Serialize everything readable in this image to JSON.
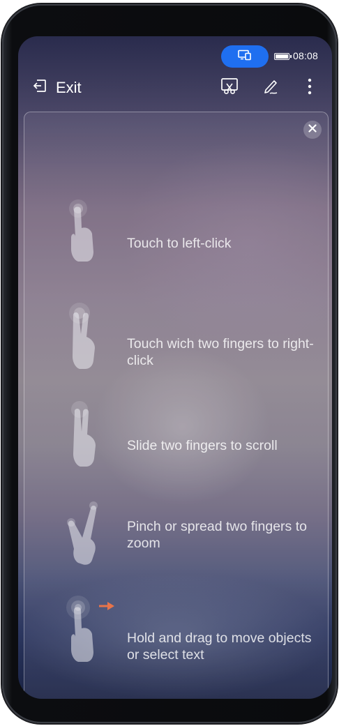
{
  "status_bar": {
    "time": "08:08",
    "cast_indicator_icon": "screen-mirroring-icon",
    "battery_icon": "battery-full-icon",
    "accent_color": "#1f6ff0"
  },
  "toolbar": {
    "exit_label": "Exit",
    "exit_icon": "exit-icon",
    "screenshot_icon": "screen-capture-icon",
    "annotate_icon": "pen-icon",
    "more_icon": "more-vertical-icon"
  },
  "tutorial": {
    "close_icon": "close-icon",
    "tips": [
      {
        "text": "Touch to left-click",
        "icon": "one-finger-tap-icon"
      },
      {
        "text": "Touch wich two fingers to right-click",
        "icon": "two-finger-tap-icon"
      },
      {
        "text": "Slide two fingers to scroll",
        "icon": "two-finger-slide-icon"
      },
      {
        "text": "Pinch or spread two fingers to zoom",
        "icon": "pinch-zoom-icon"
      },
      {
        "text": "Hold and drag to move objects or select text",
        "icon": "hold-drag-icon"
      }
    ]
  }
}
